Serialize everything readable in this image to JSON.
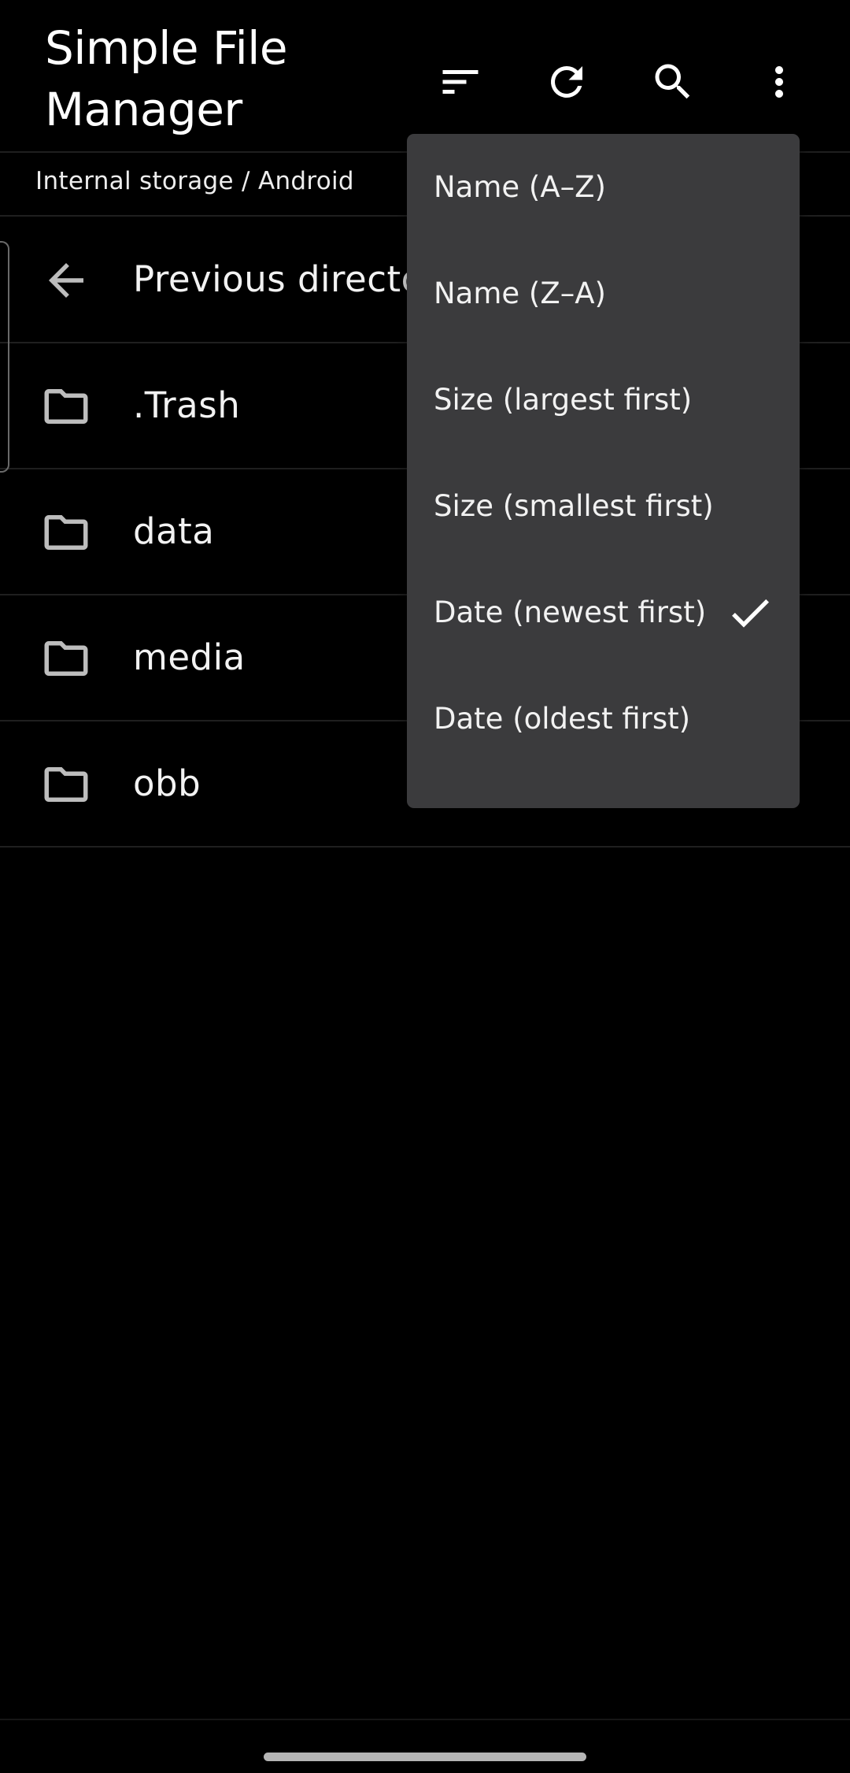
{
  "app": {
    "title": "Simple File Manager"
  },
  "toolbar": {
    "sort_icon": "sort-icon",
    "refresh_icon": "refresh-icon",
    "search_icon": "search-icon",
    "more_icon": "more-vert-icon"
  },
  "breadcrumb": {
    "path": "Internal storage / Android"
  },
  "list": {
    "items": [
      {
        "label": "Previous directory",
        "icon": "arrow-back-icon"
      },
      {
        "label": ".Trash",
        "icon": "folder-icon"
      },
      {
        "label": "data",
        "icon": "folder-icon"
      },
      {
        "label": "media",
        "icon": "folder-icon"
      },
      {
        "label": "obb",
        "icon": "folder-icon"
      }
    ]
  },
  "sort_menu": {
    "items": [
      {
        "label": "Name (A–Z)",
        "checked": false
      },
      {
        "label": "Name (Z–A)",
        "checked": false
      },
      {
        "label": "Size (largest first)",
        "checked": false
      },
      {
        "label": "Size (smallest first)",
        "checked": false
      },
      {
        "label": "Date (newest first)",
        "checked": true
      },
      {
        "label": "Date (oldest first)",
        "checked": false
      }
    ]
  },
  "colors": {
    "background": "#000000",
    "menu_background": "#3b3b3d",
    "text": "#ffffff",
    "divider": "#1f1f1f"
  }
}
